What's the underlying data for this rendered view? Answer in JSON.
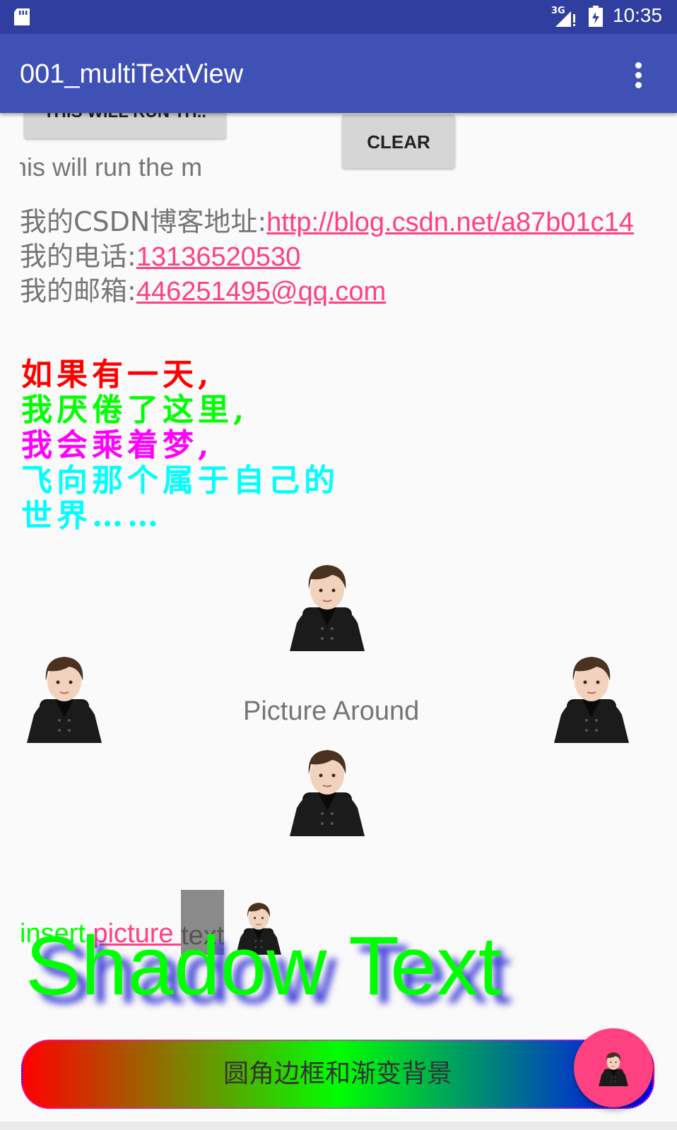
{
  "status_bar": {
    "network": "3G",
    "time": "10:35"
  },
  "toolbar": {
    "title": "001_multiTextView"
  },
  "buttons": {
    "run_label": "THIS WILL RUN TH..",
    "clear_label": "CLEAR"
  },
  "marquee_text": "his will run the m",
  "info": {
    "blog_label": "我的CSDN博客地址:",
    "blog_link": "http://blog.csdn.net/a87b01c14",
    "phone_label": "我的电话:",
    "phone_link": "13136520530",
    "mail_label": "我的邮箱:",
    "mail_link": "446251495@qq.com"
  },
  "poem": [
    {
      "text": "如果有一天,",
      "color": "#ff0000"
    },
    {
      "text": "我厌倦了这里,",
      "color": "#00ff00"
    },
    {
      "text": "我会乘着梦,",
      "color": "#ff00ff"
    },
    {
      "text": "飞向那个属于自己的",
      "color": "#00ffff"
    },
    {
      "text": "世界……",
      "color": "#00ffff"
    }
  ],
  "picture_around_text": "Picture Around",
  "insert_row": {
    "part1": "insert ",
    "part2": "picture ",
    "part3": "text"
  },
  "shadow_text": "Shadow Text",
  "gradient_button_label": "圆角边框和渐变背景",
  "colors": {
    "accent": "#ff4081",
    "primary": "#3f51b5",
    "primary_dark": "#303f9f"
  }
}
